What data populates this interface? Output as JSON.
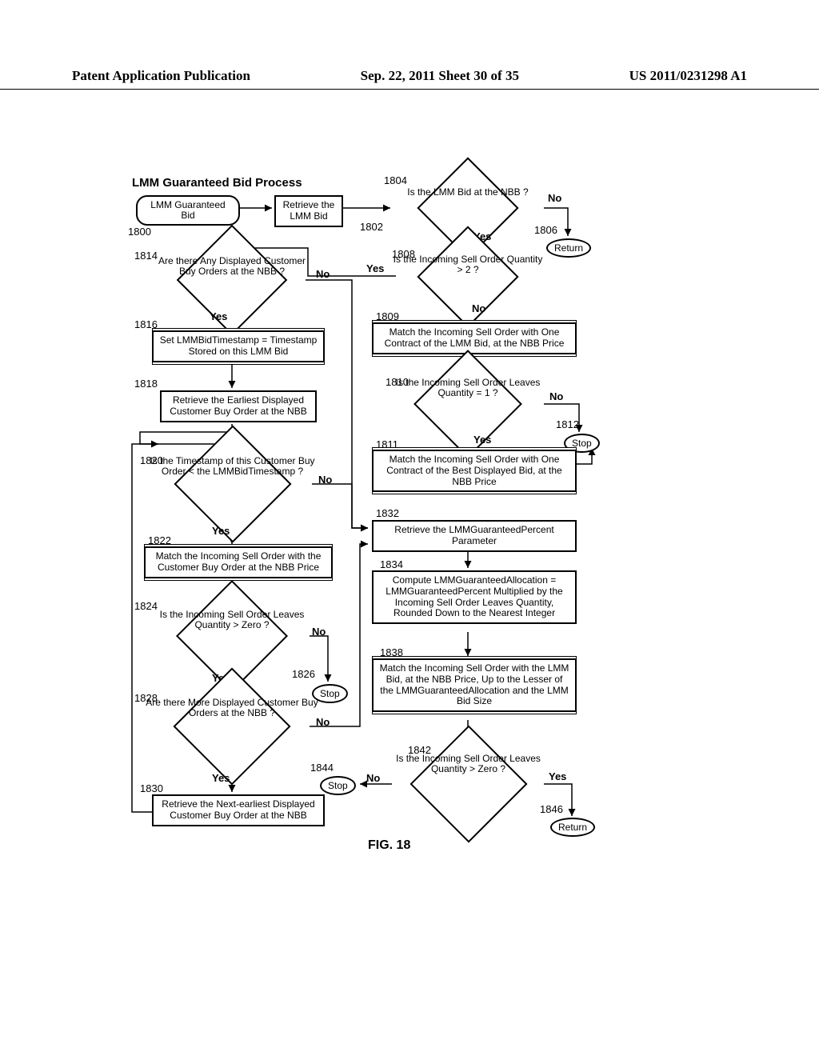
{
  "header": {
    "left": "Patent Application Publication",
    "center": "Sep. 22, 2011  Sheet 30 of 35",
    "right": "US 2011/0231298 A1"
  },
  "title": "LMM Guaranteed Bid Process",
  "figure_label": "FIG. 18",
  "refs": {
    "r1800": "1800",
    "r1802": "1802",
    "r1804": "1804",
    "r1806": "1806",
    "r1808": "1808",
    "r1809": "1809",
    "r1810": "1810",
    "r1811": "1811",
    "r1812": "1812",
    "r1814": "1814",
    "r1816": "1816",
    "r1818": "1818",
    "r1820": "1820",
    "r1822": "1822",
    "r1824": "1824",
    "r1826": "1826",
    "r1828": "1828",
    "r1830": "1830",
    "r1832": "1832",
    "r1834": "1834",
    "r1838": "1838",
    "r1842": "1842",
    "r1844": "1844",
    "r1846": "1846"
  },
  "nodes": {
    "start": "LMM Guaranteed Bid",
    "n1802": "Retrieve the LMM Bid",
    "n1804": "Is the LMM Bid at the NBB ?",
    "n1806": "Return",
    "n1808": "Is the Incoming Sell Order Quantity > 2 ?",
    "n1809": "Match the Incoming Sell Order with One Contract of the LMM Bid, at the NBB Price",
    "n1810": "Is the Incoming Sell Order Leaves Quantity = 1 ?",
    "n1811": "Match the Incoming Sell Order with One Contract of the Best Displayed Bid, at the NBB Price",
    "n1812": "Stop",
    "n1814": "Are there Any Displayed Customer Buy Orders at the NBB ?",
    "n1816": "Set LMMBidTimestamp = Timestamp Stored on this LMM Bid",
    "n1818": "Retrieve the Earliest Displayed Customer Buy Order at the NBB",
    "n1820": "Is the Timestamp of this Customer Buy Order < the LMMBidTimestamp ?",
    "n1822": "Match the Incoming Sell Order with the Customer Buy Order at the NBB Price",
    "n1824": "Is the Incoming Sell Order Leaves Quantity > Zero ?",
    "n1826": "Stop",
    "n1828": "Are there More Displayed Customer Buy Orders at the NBB ?",
    "n1830": "Retrieve the Next-earliest Displayed Customer Buy Order at the NBB",
    "n1832": "Retrieve the LMMGuaranteedPercent Parameter",
    "n1834": "Compute LMMGuaranteedAllocation = LMMGuaranteedPercent Multiplied by the Incoming Sell Order Leaves Quantity, Rounded Down to the Nearest Integer",
    "n1838": "Match the Incoming Sell Order with the LMM Bid, at the NBB Price, Up to the Lesser of the LMMGuaranteedAllocation and the LMM Bid Size",
    "n1842": "Is the Incoming Sell Order Leaves Quantity > Zero ?",
    "n1844": "Stop",
    "n1846": "Return"
  },
  "labels": {
    "yes": "Yes",
    "no": "No"
  }
}
